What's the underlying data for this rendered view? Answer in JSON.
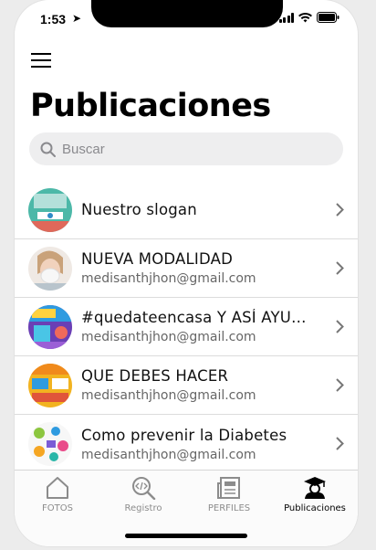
{
  "status": {
    "time": "1:53",
    "location_glyph": "➤"
  },
  "header": {
    "title": "Publicaciones"
  },
  "search": {
    "placeholder": "Buscar",
    "value": ""
  },
  "posts": [
    {
      "title": "Nuestro slogan",
      "subtitle": "",
      "avatar": "slogan-thumbnail"
    },
    {
      "title": "NUEVA MODALIDAD",
      "subtitle": "medisanthjhon@gmail.com",
      "avatar": "mask-woman-photo"
    },
    {
      "title": "#quedateencasa Y ASÍ AYUD...",
      "subtitle": "medisanthjhon@gmail.com",
      "avatar": "quedate-en-casa-thumbnail"
    },
    {
      "title": "QUE DEBES HACER",
      "subtitle": "medisanthjhon@gmail.com",
      "avatar": "infographic-thumbnail"
    },
    {
      "title": "Como prevenir la Diabetes",
      "subtitle": "medisanthjhon@gmail.com",
      "avatar": "diabetes-thumbnail"
    }
  ],
  "tabs": [
    {
      "label": "FOTOS",
      "icon": "home-icon",
      "active": false
    },
    {
      "label": "Registro",
      "icon": "code-search-icon",
      "active": false
    },
    {
      "label": "PERFILES",
      "icon": "newspaper-icon",
      "active": false
    },
    {
      "label": "Publicaciones",
      "icon": "graduate-icon",
      "active": true
    }
  ]
}
